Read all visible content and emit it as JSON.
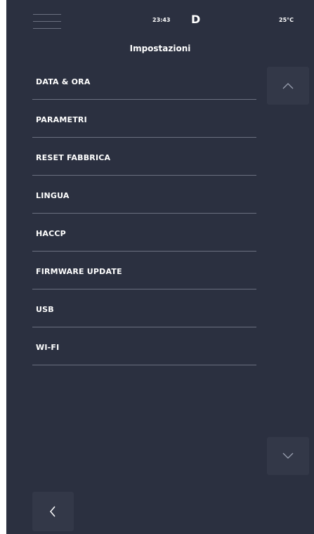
{
  "status_bar": {
    "time": "23:43",
    "mode": "D",
    "temperature": "25°C",
    "menu_icon": "hamburger-menu-icon"
  },
  "header": {
    "title": "Impostazioni"
  },
  "settings": {
    "items": [
      {
        "label": "DATA & ORA"
      },
      {
        "label": "PARAMETRI"
      },
      {
        "label": "RESET FABBRICA"
      },
      {
        "label": "LINGUA"
      },
      {
        "label": "HACCP"
      },
      {
        "label": "FIRMWARE UPDATE"
      },
      {
        "label": "USB"
      },
      {
        "label": "WI-FI"
      }
    ]
  },
  "controls": {
    "scroll_up_icon": "chevron-up-icon",
    "scroll_down_icon": "chevron-down-icon",
    "back_icon": "chevron-left-icon"
  },
  "colors": {
    "background": "#2b3040",
    "button_background": "#333848",
    "divider": "#6b7080",
    "text": "#ffffff"
  }
}
